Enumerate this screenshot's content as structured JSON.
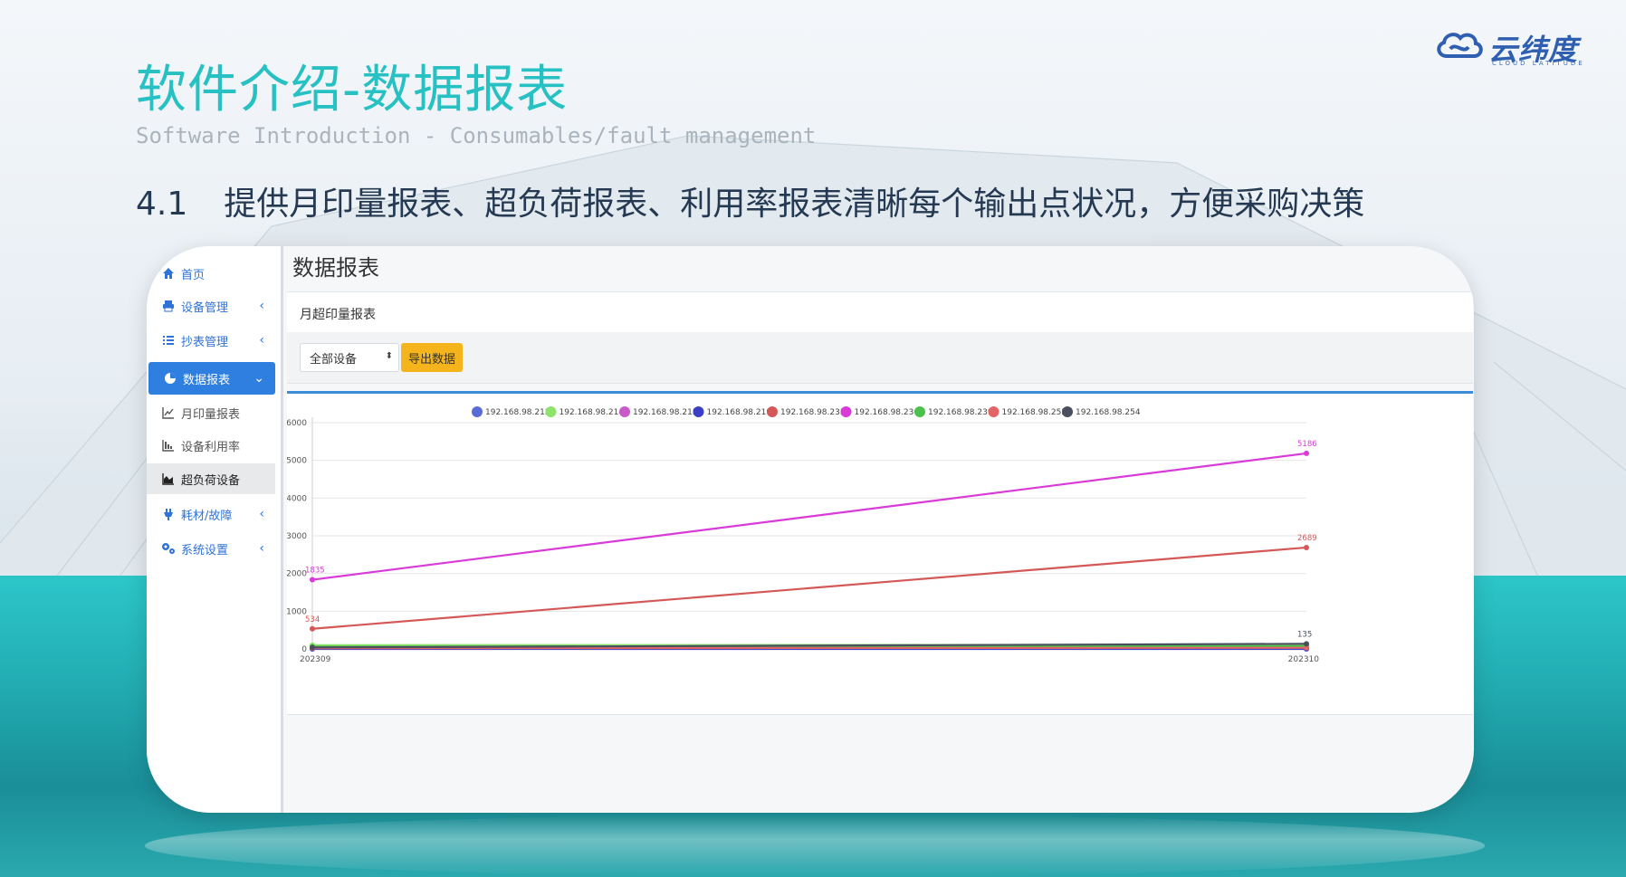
{
  "brand": {
    "name": "云纬度",
    "tagline": "CLOUD LATITUDE"
  },
  "slide": {
    "title": "软件介绍-数据报表",
    "subtitle": "Software Introduction - Consumables/fault management",
    "section_number": "4.1",
    "section_text": "提供月印量报表、超负荷报表、利用率报表清晰每个输出点状况，方便采购决策"
  },
  "sidebar": {
    "items": [
      {
        "label": "首页",
        "icon": "home-icon",
        "has_chevron": false
      },
      {
        "label": "设备管理",
        "icon": "printer-icon",
        "has_chevron": true
      },
      {
        "label": "抄表管理",
        "icon": "list-icon",
        "has_chevron": true
      },
      {
        "label": "数据报表",
        "icon": "pie-chart-icon",
        "has_chevron": true,
        "active": true
      },
      {
        "label": "耗材/故障",
        "icon": "plug-icon",
        "has_chevron": true
      },
      {
        "label": "系统设置",
        "icon": "gears-icon",
        "has_chevron": true
      }
    ],
    "sub_items": [
      {
        "label": "月印量报表",
        "icon": "line-chart-icon"
      },
      {
        "label": "设备利用率",
        "icon": "bar-chart-icon"
      },
      {
        "label": "超负荷设备",
        "icon": "area-chart-icon",
        "current": true
      }
    ]
  },
  "main": {
    "page_title": "数据报表",
    "panel_title": "月超印量报表",
    "device_select": {
      "value": "全部设备"
    },
    "export_label": "导出数据"
  },
  "colors": {
    "title_teal": "#27c0c3",
    "accent_blue": "#2e7fe0",
    "export_yellow": "#f5b41b",
    "heading_dark": "#253a52"
  },
  "chart_data": {
    "type": "line",
    "x": [
      "202309",
      "202310"
    ],
    "ylim": [
      0,
      6000
    ],
    "yticks": [
      0,
      1000,
      2000,
      3000,
      4000,
      5000,
      6000
    ],
    "grid": true,
    "legend": "top-center",
    "series": [
      {
        "name": "192.168.98.212",
        "color": "#5b6bd6",
        "values": [
          10,
          20
        ]
      },
      {
        "name": "192.168.98.214",
        "color": "#8ee46a",
        "values": [
          100,
          110
        ]
      },
      {
        "name": "192.168.98.215",
        "color": "#c85bc9",
        "values": [
          30,
          50
        ]
      },
      {
        "name": "192.168.98.219",
        "color": "#3b3fc7",
        "values": [
          0,
          0
        ]
      },
      {
        "name": "192.168.98.235",
        "color": "#d45858",
        "values": [
          534,
          2689
        ],
        "labels": [
          "534",
          "2689"
        ]
      },
      {
        "name": "192.168.98.236",
        "color": "#d93ad8",
        "values": [
          1835,
          5186
        ],
        "labels": [
          "1835",
          "5186"
        ]
      },
      {
        "name": "192.168.98.239",
        "color": "#4bc14b",
        "values": [
          60,
          70
        ]
      },
      {
        "name": "192.168.98.252",
        "color": "#e26464",
        "values": [
          20,
          30
        ]
      },
      {
        "name": "192.168.98.254",
        "color": "#4a4f60",
        "values": [
          40,
          135
        ],
        "labels": [
          "",
          "135"
        ]
      }
    ]
  }
}
